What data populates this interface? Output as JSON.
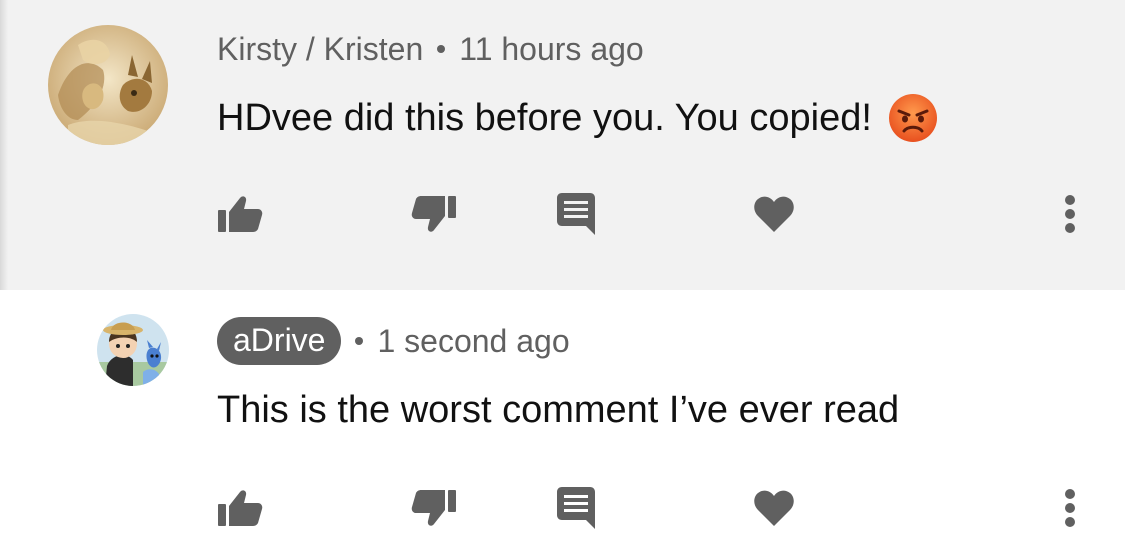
{
  "comments": [
    {
      "author": "Kirsty / Kristen",
      "time": "11 hours ago",
      "text": "HDvee did this before you. You copied!",
      "emoji_icon": "angry-face-emoji",
      "is_channel_owner": false
    },
    {
      "author": "aDrive",
      "time": "1 second ago",
      "text": "This is the worst comment I’ve ever read",
      "is_channel_owner": true
    }
  ],
  "icons": {
    "like": "thumbs-up-icon",
    "dislike": "thumbs-down-icon",
    "reply": "comment-reply-icon",
    "heart": "heart-icon",
    "more": "more-vertical-icon"
  },
  "colors": {
    "highlighted_bg": "#f2f2f2",
    "icon": "#606060",
    "meta_text": "#606060",
    "owner_badge_bg": "#606060"
  }
}
